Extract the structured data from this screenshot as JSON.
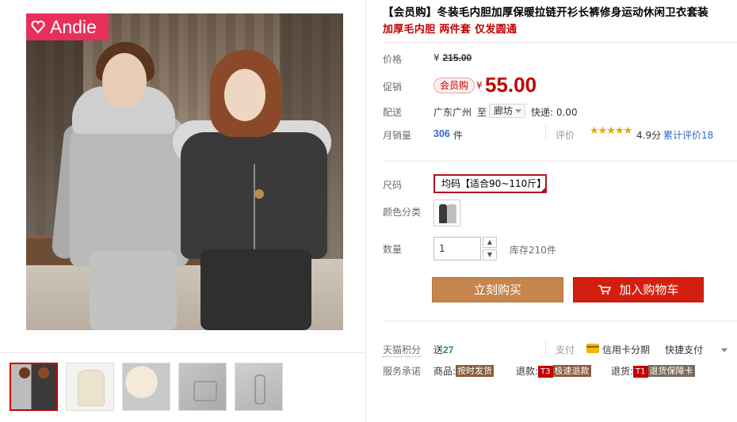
{
  "gallery": {
    "brand_logo": "Andie",
    "thumbnails": [
      {
        "name": "thumb-1",
        "active": true
      },
      {
        "name": "thumb-2",
        "active": false
      },
      {
        "name": "thumb-3",
        "active": false
      },
      {
        "name": "thumb-4",
        "active": false
      },
      {
        "name": "thumb-5",
        "active": false
      }
    ]
  },
  "product": {
    "title": "【会员购】冬装毛内胆加厚保暖拉链开衫长裤修身运动休闲卫衣套装",
    "subtitle": "加厚毛内胆 两件套 仅发圆通"
  },
  "price": {
    "label": "价格",
    "currency": "¥",
    "original": "215.00",
    "promo_label": "促销",
    "member_tag": "会员购",
    "promo_currency": "¥",
    "promo_value": "55.00"
  },
  "shipping": {
    "label": "配送",
    "from": "广东广州",
    "to_word": "至",
    "region": "廊坊",
    "fee": "快递: 0.00"
  },
  "sales": {
    "label": "月销量",
    "value": "306",
    "unit": "件",
    "rating_label": "评价",
    "stars": "★★★★★",
    "score": "4.9分",
    "review_link": "累计评价18"
  },
  "options": {
    "size_label": "尺码",
    "size_value": "均码【适合90~110斤】",
    "color_label": "颜色分类",
    "qty_label": "数量",
    "qty_value": "1",
    "qty_up": "▲",
    "qty_down": "▼",
    "stock": "库存210件"
  },
  "buttons": {
    "buy_now": "立刻购买",
    "add_to_cart": "加入购物车"
  },
  "extras": {
    "points_label": "天猫积分",
    "points_prefix": "送",
    "points_value": "27",
    "pay_label": "支付",
    "card_label": "信用卡分期",
    "quick_pay": "快捷支付",
    "promise_label": "服务承诺",
    "goods_label": "商品:",
    "goods_badge": "按时发货",
    "refund_label": "退款:",
    "refund_code": "T3",
    "refund_badge": "极速退款",
    "return_label": "退货:",
    "return_code": "T1",
    "return_badge": "退货保障卡"
  },
  "colors": {
    "accent_red": "#c40000",
    "buy_button": "#c5854d",
    "cart_button": "#d41f10",
    "link_blue": "#3366cc",
    "brand_pink": "#e6305b"
  }
}
